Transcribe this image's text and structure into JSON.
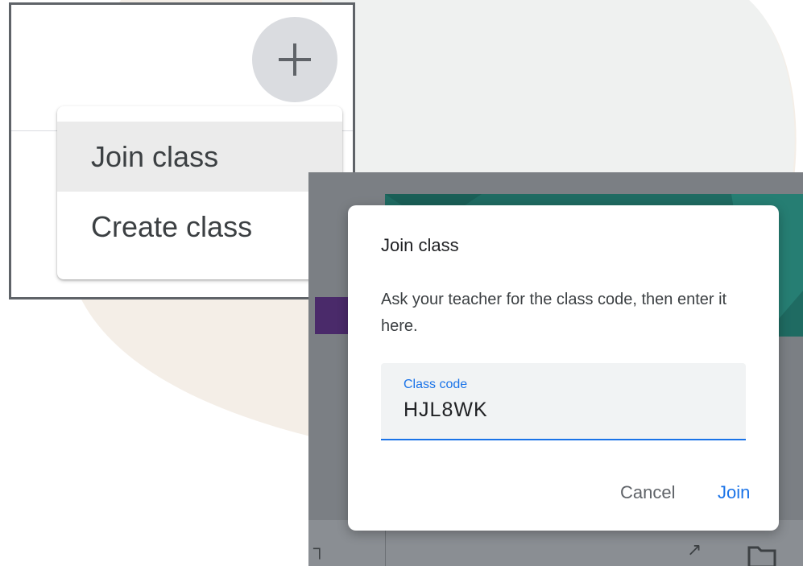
{
  "colors": {
    "accent": "#1a73e8",
    "overlay": "#7b7f84",
    "banner": "#1f6b62",
    "menu_highlight": "#ebebeb",
    "background_blob": "#f4eee7"
  },
  "add_menu": {
    "add_button_icon": "plus-icon",
    "items": [
      {
        "label": "Join class",
        "highlighted": true
      },
      {
        "label": "Create class",
        "highlighted": false
      }
    ]
  },
  "join_dialog": {
    "title": "Join class",
    "description": "Ask your teacher for the class code, then enter it here.",
    "field": {
      "label": "Class code",
      "value": "HJL8WK"
    },
    "actions": {
      "cancel": "Cancel",
      "join": "Join"
    }
  }
}
